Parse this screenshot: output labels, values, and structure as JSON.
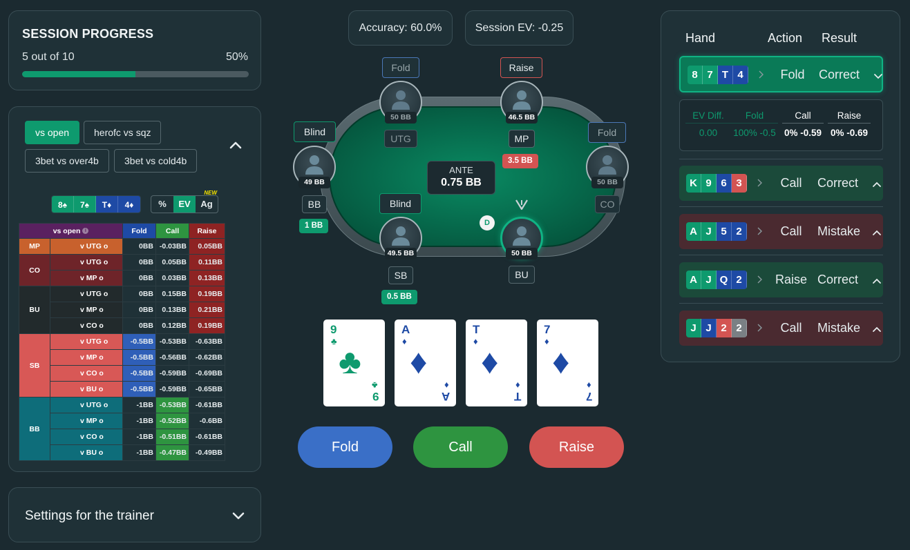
{
  "progress": {
    "title": "SESSION PROGRESS",
    "count_text": "5 out of 10",
    "percent_text": "50%",
    "percent": 50
  },
  "spot_buttons": [
    {
      "label": "vs open",
      "active": true
    },
    {
      "label": "herofc vs sqz",
      "active": false
    },
    {
      "label": "3bet vs over4b",
      "active": false
    },
    {
      "label": "3bet vs cold4b",
      "active": false
    }
  ],
  "hand_chips": [
    {
      "label": "8♠",
      "color": "#0e9a6e"
    },
    {
      "label": "7♠",
      "color": "#0e9a6e"
    },
    {
      "label": "T♦",
      "color": "#1e4aa5"
    },
    {
      "label": "4♦",
      "color": "#1e4aa5"
    }
  ],
  "mode_chips": [
    {
      "label": "%",
      "active": false
    },
    {
      "label": "EV",
      "active": true
    },
    {
      "label": "Ag",
      "active": false,
      "badge": "NEW"
    }
  ],
  "range_table": {
    "header": {
      "spot": "vs open",
      "fold": "Fold",
      "call": "Call",
      "raise": "Raise"
    },
    "groups": [
      {
        "pos": "MP",
        "color": "#c8612d",
        "rows": [
          {
            "spot": "v UTG o",
            "fold": "0BB",
            "call": "-0.03BB",
            "raise": "0.05BB"
          }
        ]
      },
      {
        "pos": "CO",
        "color": "#6e2429",
        "rows": [
          {
            "spot": "v UTG o",
            "fold": "0BB",
            "call": "0.05BB",
            "raise": "0.11BB"
          },
          {
            "spot": "v MP o",
            "fold": "0BB",
            "call": "0.03BB",
            "raise": "0.13BB"
          }
        ]
      },
      {
        "pos": "BU",
        "color": "#222a2c",
        "rows": [
          {
            "spot": "v UTG o",
            "fold": "0BB",
            "call": "0.15BB",
            "raise": "0.19BB"
          },
          {
            "spot": "v MP o",
            "fold": "0BB",
            "call": "0.13BB",
            "raise": "0.21BB"
          },
          {
            "spot": "v CO o",
            "fold": "0BB",
            "call": "0.12BB",
            "raise": "0.19BB"
          }
        ]
      },
      {
        "pos": "SB",
        "color": "#d85856",
        "rows": [
          {
            "spot": "v UTG o",
            "fold": "-0.5BB",
            "call": "-0.53BB",
            "raise": "-0.63BB"
          },
          {
            "spot": "v MP o",
            "fold": "-0.5BB",
            "call": "-0.56BB",
            "raise": "-0.62BB"
          },
          {
            "spot": "v CO o",
            "fold": "-0.5BB",
            "call": "-0.59BB",
            "raise": "-0.69BB"
          },
          {
            "spot": "v BU o",
            "fold": "-0.5BB",
            "call": "-0.59BB",
            "raise": "-0.65BB"
          }
        ]
      },
      {
        "pos": "BB",
        "color": "#0e6d7a",
        "rows": [
          {
            "spot": "v UTG o",
            "fold": "-1BB",
            "call": "-0.53BB",
            "raise": "-0.61BB"
          },
          {
            "spot": "v MP o",
            "fold": "-1BB",
            "call": "-0.52BB",
            "raise": "-0.6BB"
          },
          {
            "spot": "v CO o",
            "fold": "-1BB",
            "call": "-0.51BB",
            "raise": "-0.61BB"
          },
          {
            "spot": "v BU o",
            "fold": "-1BB",
            "call": "-0.47BB",
            "raise": "-0.49BB"
          }
        ]
      }
    ]
  },
  "settings": {
    "label": "Settings for the trainer"
  },
  "stats": {
    "accuracy": "Accuracy: 60.0%",
    "session_ev": "Session EV: -0.25"
  },
  "ante": {
    "label": "ANTE",
    "value": "0.75 BB"
  },
  "seats": {
    "utg": {
      "name": "UTG",
      "stack": "50 BB",
      "action": "Fold"
    },
    "mp": {
      "name": "MP",
      "stack": "46.5 BB",
      "action": "Raise",
      "bet": "3.5 BB"
    },
    "co": {
      "name": "CO",
      "stack": "50 BB",
      "action": "Fold"
    },
    "bb": {
      "name": "BB",
      "stack": "49 BB",
      "action": "Blind",
      "bet": "1 BB"
    },
    "sb": {
      "name": "SB",
      "stack": "49.5 BB",
      "action": "Blind",
      "bet": "0.5 BB"
    },
    "bu": {
      "name": "BU",
      "stack": "50 BB"
    }
  },
  "dealer_button": "D",
  "hero_cards": [
    {
      "rank": "9",
      "suit": "♣",
      "color": "#0e9a6e"
    },
    {
      "rank": "A",
      "suit": "♦",
      "color": "#1e4aa5"
    },
    {
      "rank": "T",
      "suit": "♦",
      "color": "#1e4aa5"
    },
    {
      "rank": "7",
      "suit": "♦",
      "color": "#1e4aa5"
    }
  ],
  "actions": {
    "fold": "Fold",
    "call": "Call",
    "raise": "Raise"
  },
  "colors": {
    "fold": "#3a6fc7",
    "call": "#2e9440",
    "raise": "#d35452",
    "accent": "#0e9a6e"
  },
  "history": {
    "headers": {
      "hand": "Hand",
      "action": "Action",
      "result": "Result"
    },
    "rows": [
      {
        "cards": [
          {
            "r": "8",
            "c": "#0e9a6e"
          },
          {
            "r": "7",
            "c": "#0e9a6e"
          },
          {
            "r": "T",
            "c": "#1e4aa5"
          },
          {
            "r": "4",
            "c": "#1e4aa5"
          }
        ],
        "action": "Fold",
        "result": "Correct",
        "status": "correct",
        "expanded": true
      },
      {
        "cards": [
          {
            "r": "K",
            "c": "#0e9a6e"
          },
          {
            "r": "9",
            "c": "#0e9a6e"
          },
          {
            "r": "6",
            "c": "#1e4aa5"
          },
          {
            "r": "3",
            "c": "#d35452"
          }
        ],
        "action": "Call",
        "result": "Correct",
        "status": "correct",
        "expanded": false
      },
      {
        "cards": [
          {
            "r": "A",
            "c": "#0e9a6e"
          },
          {
            "r": "J",
            "c": "#0e9a6e"
          },
          {
            "r": "5",
            "c": "#1e4aa5"
          },
          {
            "r": "2",
            "c": "#1e4aa5"
          }
        ],
        "action": "Call",
        "result": "Mistake",
        "status": "mistake",
        "expanded": false
      },
      {
        "cards": [
          {
            "r": "A",
            "c": "#0e9a6e"
          },
          {
            "r": "J",
            "c": "#0e9a6e"
          },
          {
            "r": "Q",
            "c": "#1e4aa5"
          },
          {
            "r": "2",
            "c": "#1e4aa5"
          }
        ],
        "action": "Raise",
        "result": "Correct",
        "status": "correct",
        "expanded": false
      },
      {
        "cards": [
          {
            "r": "J",
            "c": "#0e9a6e"
          },
          {
            "r": "J",
            "c": "#1e4aa5"
          },
          {
            "r": "2",
            "c": "#d35452"
          },
          {
            "r": "2",
            "c": "#7a8084"
          }
        ],
        "action": "Call",
        "result": "Mistake",
        "status": "mistake",
        "expanded": false
      }
    ],
    "detail": {
      "ev_diff_label": "EV Diff.",
      "ev_diff_value": "0.00",
      "fold_label": "Fold",
      "fold_value": "100% -0.5",
      "call_label": "Call",
      "call_value": "0% -0.59",
      "raise_label": "Raise",
      "raise_value": "0% -0.69"
    }
  }
}
